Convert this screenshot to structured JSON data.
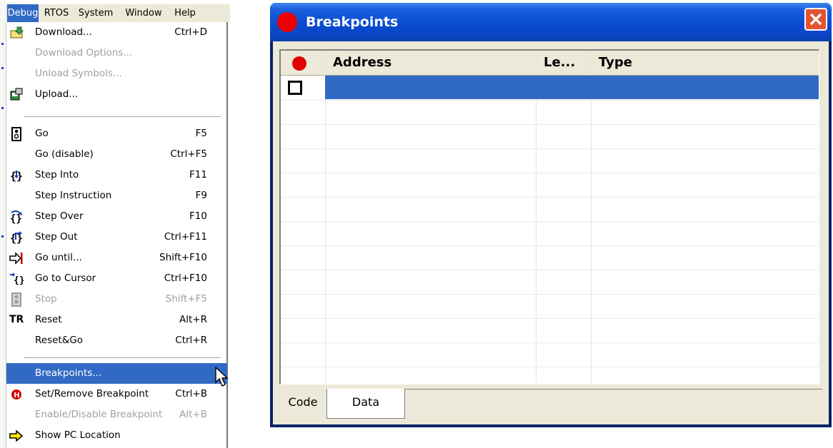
{
  "menubar": {
    "items": [
      "Debug",
      "RTOS",
      "System",
      "Window",
      "Help"
    ],
    "active": "Debug"
  },
  "debug_menu": {
    "items": [
      {
        "label": "Download...",
        "shortcut": "Ctrl+D",
        "icon": "download-icon",
        "enabled": true
      },
      {
        "label": "Download Options...",
        "shortcut": "",
        "icon": "",
        "enabled": false
      },
      {
        "label": "Unload Symbols...",
        "shortcut": "",
        "icon": "",
        "enabled": false
      },
      {
        "label": "Upload...",
        "shortcut": "",
        "icon": "upload-icon",
        "enabled": true
      },
      {
        "label": "Go",
        "shortcut": "F5",
        "icon": "traffic-light-icon",
        "enabled": true
      },
      {
        "label": "Go (disable)",
        "shortcut": "Ctrl+F5",
        "icon": "",
        "enabled": true
      },
      {
        "label": "Step Into",
        "shortcut": "F11",
        "icon": "step-into-icon",
        "enabled": true
      },
      {
        "label": "Step Instruction",
        "shortcut": "F9",
        "icon": "",
        "enabled": true
      },
      {
        "label": "Step Over",
        "shortcut": "F10",
        "icon": "step-over-icon",
        "enabled": true
      },
      {
        "label": "Step Out",
        "shortcut": "Ctrl+F11",
        "icon": "step-out-icon",
        "enabled": true
      },
      {
        "label": "Go until...",
        "shortcut": "Shift+F10",
        "icon": "go-until-icon",
        "enabled": true
      },
      {
        "label": "Go to Cursor",
        "shortcut": "Ctrl+F10",
        "icon": "go-to-cursor-icon",
        "enabled": true
      },
      {
        "label": "Stop",
        "shortcut": "Shift+F5",
        "icon": "stop-light-icon",
        "enabled": false
      },
      {
        "label": "Reset",
        "shortcut": "Alt+R",
        "icon": "reset-icon",
        "enabled": true
      },
      {
        "label": "Reset&Go",
        "shortcut": "Ctrl+R",
        "icon": "",
        "enabled": true
      },
      {
        "label": "Breakpoints...",
        "shortcut": "",
        "icon": "",
        "enabled": true,
        "highlighted": true
      },
      {
        "label": "Set/Remove Breakpoint",
        "shortcut": "Ctrl+B",
        "icon": "breakpoint-icon",
        "enabled": true
      },
      {
        "label": "Enable/Disable Breakpoint",
        "shortcut": "Alt+B",
        "icon": "",
        "enabled": false
      },
      {
        "label": "Show PC Location",
        "shortcut": "",
        "icon": "arrow-right-icon",
        "enabled": true
      }
    ],
    "reset_icon_text": "TR"
  },
  "breakpoints_window": {
    "title": "Breakpoints",
    "columns": [
      "Address",
      "Le...",
      "Type"
    ],
    "tabs": [
      "Code",
      "Data"
    ],
    "active_tab": "Data",
    "accent": "#316ac5"
  }
}
